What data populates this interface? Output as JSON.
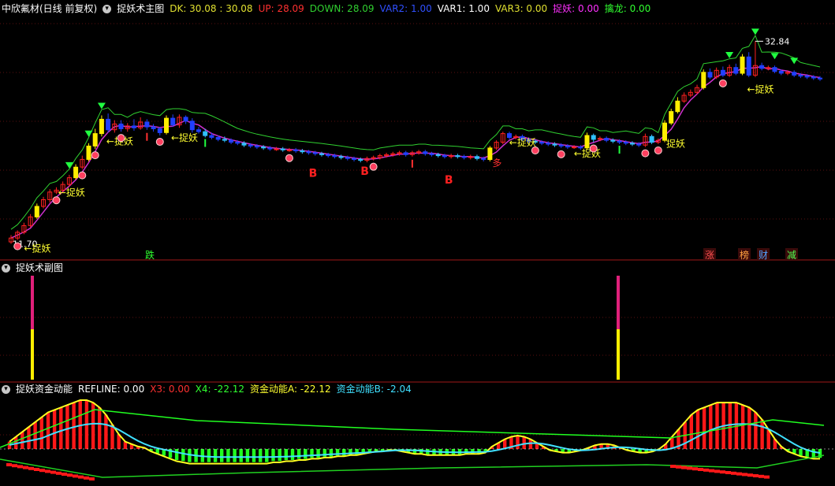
{
  "panel1": {
    "stock": "中欣氟材(日线 前复权)",
    "name": "捉妖术主图",
    "items": [
      {
        "label": "DK: 30.08 : 30.08",
        "color": "#e0e030"
      },
      {
        "label": "UP: 28.09",
        "color": "#ff3030"
      },
      {
        "label": "DOWN: 28.09",
        "color": "#30d030"
      },
      {
        "label": "VAR2: 1.00",
        "color": "#3050ff"
      },
      {
        "label": "VAR1: 1.00",
        "color": "#ffffff"
      },
      {
        "label": "VAR3: 0.00",
        "color": "#e0e030"
      },
      {
        "label": "捉妖: 0.00",
        "color": "#ff30ff"
      },
      {
        "label": "擒龙: 0.00",
        "color": "#30ff30"
      }
    ]
  },
  "panel2": {
    "name": "捉妖术副图"
  },
  "panel3": {
    "name": "捉妖资金动能",
    "items": [
      {
        "label": "REFLINE: 0.00",
        "color": "#ffffff"
      },
      {
        "label": "X3: 0.00",
        "color": "#ff3030"
      },
      {
        "label": "X4: -22.12",
        "color": "#30ff30"
      },
      {
        "label": "资金动能A: -22.12",
        "color": "#ffff30"
      },
      {
        "label": "资金动能B: -2.04",
        "color": "#40e0ff"
      }
    ]
  },
  "chart_data": {
    "type": "candlestick",
    "price_labels": {
      "high": "32.84",
      "low": "11.70"
    },
    "signal_text": {
      "zhuoyao": "捉妖",
      "arrow_zhuoyao": "←捉妖",
      "b": "B",
      "duo": "多",
      "die": "跌"
    },
    "events": [
      "涨",
      "榜",
      "财",
      "减"
    ],
    "candles": [
      {
        "o": 11.9,
        "c": 12.3,
        "h": 12.6,
        "l": 11.7,
        "up": true
      },
      {
        "o": 12.3,
        "c": 12.9,
        "h": 13.1,
        "l": 12.1,
        "up": true
      },
      {
        "o": 12.9,
        "c": 13.6,
        "h": 13.9,
        "l": 12.7,
        "up": true
      },
      {
        "o": 13.6,
        "c": 14.5,
        "h": 14.8,
        "l": 13.4,
        "up": true
      },
      {
        "o": 14.5,
        "c": 15.6,
        "h": 15.9,
        "l": 14.3,
        "up": true
      },
      {
        "o": 15.6,
        "c": 16.3,
        "h": 16.6,
        "l": 15.4,
        "up": true
      },
      {
        "o": 16.3,
        "c": 17.1,
        "h": 17.4,
        "l": 16.0,
        "up": true
      },
      {
        "o": 17.1,
        "c": 17.3,
        "h": 17.6,
        "l": 16.9,
        "up": true
      },
      {
        "o": 17.3,
        "c": 17.9,
        "h": 18.2,
        "l": 17.1,
        "up": true
      },
      {
        "o": 17.9,
        "c": 18.6,
        "h": 18.9,
        "l": 17.7,
        "up": true
      },
      {
        "o": 18.6,
        "c": 19.7,
        "h": 20.0,
        "l": 18.4,
        "up": true
      },
      {
        "o": 19.7,
        "c": 20.5,
        "h": 20.9,
        "l": 19.5,
        "up": true
      },
      {
        "o": 20.5,
        "c": 21.9,
        "h": 22.2,
        "l": 20.3,
        "up": true
      },
      {
        "o": 21.9,
        "c": 23.2,
        "h": 23.7,
        "l": 21.6,
        "up": true
      },
      {
        "o": 23.2,
        "c": 24.7,
        "h": 25.1,
        "l": 22.9,
        "up": true
      },
      {
        "o": 24.7,
        "c": 23.6,
        "h": 25.3,
        "l": 23.3,
        "up": false
      },
      {
        "o": 23.6,
        "c": 24.2,
        "h": 24.6,
        "l": 23.3,
        "up": true
      },
      {
        "o": 24.2,
        "c": 23.7,
        "h": 24.6,
        "l": 23.4,
        "up": false
      },
      {
        "o": 23.7,
        "c": 24.0,
        "h": 24.3,
        "l": 23.4,
        "up": true
      },
      {
        "o": 24.0,
        "c": 23.8,
        "h": 24.7,
        "l": 23.5,
        "up": false
      },
      {
        "o": 23.8,
        "c": 24.4,
        "h": 24.9,
        "l": 23.6,
        "up": true
      },
      {
        "o": 24.4,
        "c": 23.9,
        "h": 24.7,
        "l": 23.6,
        "up": false
      },
      {
        "o": 23.9,
        "c": 23.7,
        "h": 24.2,
        "l": 23.4,
        "up": false
      },
      {
        "o": 23.7,
        "c": 23.3,
        "h": 23.9,
        "l": 23.0,
        "up": false
      },
      {
        "o": 23.3,
        "c": 24.8,
        "h": 25.1,
        "l": 23.1,
        "up": true
      },
      {
        "o": 24.8,
        "c": 24.1,
        "h": 25.2,
        "l": 23.9,
        "up": false
      },
      {
        "o": 24.1,
        "c": 24.9,
        "h": 25.2,
        "l": 23.8,
        "up": true
      },
      {
        "o": 24.9,
        "c": 24.5,
        "h": 25.1,
        "l": 24.2,
        "up": false
      },
      {
        "o": 24.5,
        "c": 23.6,
        "h": 24.8,
        "l": 23.3,
        "up": false
      },
      {
        "o": 23.6,
        "c": 23.4,
        "h": 23.9,
        "l": 23.2,
        "up": false
      },
      {
        "o": 23.4,
        "c": 23.0,
        "h": 23.7,
        "l": 22.8,
        "up": false
      },
      {
        "o": 23.0,
        "c": 22.8,
        "h": 23.3,
        "l": 22.6,
        "up": false
      },
      {
        "o": 22.8,
        "c": 22.6,
        "h": 23.0,
        "l": 22.4,
        "up": false
      },
      {
        "o": 22.6,
        "c": 22.5,
        "h": 22.9,
        "l": 22.3,
        "up": false
      },
      {
        "o": 22.5,
        "c": 22.3,
        "h": 22.7,
        "l": 22.1,
        "up": false
      },
      {
        "o": 22.3,
        "c": 22.2,
        "h": 22.5,
        "l": 22.0,
        "up": false
      },
      {
        "o": 22.2,
        "c": 22.0,
        "h": 22.4,
        "l": 21.8,
        "up": false
      },
      {
        "o": 22.0,
        "c": 21.9,
        "h": 22.2,
        "l": 21.7,
        "up": false
      },
      {
        "o": 21.9,
        "c": 21.8,
        "h": 22.1,
        "l": 21.6,
        "up": false
      },
      {
        "o": 21.8,
        "c": 21.7,
        "h": 22.0,
        "l": 21.5,
        "up": false
      },
      {
        "o": 21.7,
        "c": 21.6,
        "h": 21.9,
        "l": 21.4,
        "up": false
      },
      {
        "o": 21.6,
        "c": 21.6,
        "h": 21.8,
        "l": 21.4,
        "up": true
      },
      {
        "o": 21.6,
        "c": 21.5,
        "h": 21.8,
        "l": 21.3,
        "up": false
      },
      {
        "o": 21.5,
        "c": 21.5,
        "h": 21.7,
        "l": 21.3,
        "up": true
      },
      {
        "o": 21.5,
        "c": 21.4,
        "h": 21.7,
        "l": 21.2,
        "up": false
      },
      {
        "o": 21.4,
        "c": 21.3,
        "h": 21.6,
        "l": 21.1,
        "up": false
      },
      {
        "o": 21.3,
        "c": 21.2,
        "h": 21.5,
        "l": 21.0,
        "up": false
      },
      {
        "o": 21.2,
        "c": 21.1,
        "h": 21.4,
        "l": 20.9,
        "up": false
      },
      {
        "o": 21.1,
        "c": 21.0,
        "h": 21.3,
        "l": 20.8,
        "up": false
      },
      {
        "o": 21.0,
        "c": 20.9,
        "h": 21.2,
        "l": 20.7,
        "up": false
      },
      {
        "o": 20.9,
        "c": 20.8,
        "h": 21.1,
        "l": 20.6,
        "up": false
      },
      {
        "o": 20.8,
        "c": 20.7,
        "h": 21.0,
        "l": 20.5,
        "up": false
      },
      {
        "o": 20.7,
        "c": 20.6,
        "h": 20.9,
        "l": 20.4,
        "up": false
      },
      {
        "o": 20.6,
        "c": 20.5,
        "h": 20.8,
        "l": 20.3,
        "up": false
      },
      {
        "o": 20.5,
        "c": 20.4,
        "h": 20.7,
        "l": 20.2,
        "up": false
      },
      {
        "o": 20.4,
        "c": 20.6,
        "h": 20.8,
        "l": 20.2,
        "up": true
      },
      {
        "o": 20.6,
        "c": 20.7,
        "h": 20.9,
        "l": 20.4,
        "up": true
      },
      {
        "o": 20.7,
        "c": 20.9,
        "h": 21.1,
        "l": 20.5,
        "up": true
      },
      {
        "o": 20.9,
        "c": 21.0,
        "h": 21.2,
        "l": 20.7,
        "up": true
      },
      {
        "o": 21.0,
        "c": 21.1,
        "h": 21.3,
        "l": 20.8,
        "up": true
      },
      {
        "o": 21.1,
        "c": 21.2,
        "h": 21.4,
        "l": 20.9,
        "up": true
      },
      {
        "o": 21.2,
        "c": 21.0,
        "h": 21.4,
        "l": 20.8,
        "up": false
      },
      {
        "o": 21.0,
        "c": 21.2,
        "h": 21.4,
        "l": 20.8,
        "up": true
      },
      {
        "o": 21.2,
        "c": 21.3,
        "h": 21.5,
        "l": 21.0,
        "up": true
      },
      {
        "o": 21.3,
        "c": 21.1,
        "h": 21.5,
        "l": 20.9,
        "up": false
      },
      {
        "o": 21.1,
        "c": 21.0,
        "h": 21.3,
        "l": 20.8,
        "up": false
      },
      {
        "o": 21.0,
        "c": 20.9,
        "h": 21.2,
        "l": 20.7,
        "up": false
      },
      {
        "o": 20.9,
        "c": 20.8,
        "h": 21.1,
        "l": 20.6,
        "up": false
      },
      {
        "o": 20.8,
        "c": 20.9,
        "h": 21.1,
        "l": 20.6,
        "up": true
      },
      {
        "o": 20.9,
        "c": 20.8,
        "h": 21.1,
        "l": 20.6,
        "up": false
      },
      {
        "o": 20.8,
        "c": 20.7,
        "h": 21.0,
        "l": 20.5,
        "up": false
      },
      {
        "o": 20.7,
        "c": 20.8,
        "h": 21.0,
        "l": 20.5,
        "up": true
      },
      {
        "o": 20.8,
        "c": 20.6,
        "h": 21.0,
        "l": 20.4,
        "up": false
      },
      {
        "o": 20.6,
        "c": 20.5,
        "h": 20.8,
        "l": 20.3,
        "up": false
      },
      {
        "o": 20.5,
        "c": 21.7,
        "h": 21.9,
        "l": 20.3,
        "up": true
      },
      {
        "o": 21.7,
        "c": 22.3,
        "h": 22.5,
        "l": 21.5,
        "up": true
      },
      {
        "o": 22.3,
        "c": 23.2,
        "h": 23.4,
        "l": 22.1,
        "up": true
      },
      {
        "o": 23.2,
        "c": 22.8,
        "h": 23.4,
        "l": 22.6,
        "up": false
      },
      {
        "o": 22.8,
        "c": 22.9,
        "h": 23.1,
        "l": 22.6,
        "up": true
      },
      {
        "o": 22.9,
        "c": 22.6,
        "h": 23.1,
        "l": 22.4,
        "up": false
      },
      {
        "o": 22.6,
        "c": 22.4,
        "h": 22.8,
        "l": 22.2,
        "up": false
      },
      {
        "o": 22.4,
        "c": 22.3,
        "h": 22.6,
        "l": 22.1,
        "up": false
      },
      {
        "o": 22.3,
        "c": 22.2,
        "h": 22.5,
        "l": 22.0,
        "up": false
      },
      {
        "o": 22.2,
        "c": 22.1,
        "h": 22.4,
        "l": 21.9,
        "up": false
      },
      {
        "o": 22.1,
        "c": 22.0,
        "h": 22.3,
        "l": 21.8,
        "up": false
      },
      {
        "o": 22.0,
        "c": 21.9,
        "h": 22.2,
        "l": 21.7,
        "up": false
      },
      {
        "o": 21.9,
        "c": 21.8,
        "h": 22.1,
        "l": 21.6,
        "up": false
      },
      {
        "o": 21.8,
        "c": 21.8,
        "h": 22.0,
        "l": 21.6,
        "up": true
      },
      {
        "o": 21.8,
        "c": 21.7,
        "h": 22.0,
        "l": 21.5,
        "up": false
      },
      {
        "o": 21.7,
        "c": 23.0,
        "h": 23.3,
        "l": 21.5,
        "up": true
      },
      {
        "o": 23.0,
        "c": 22.6,
        "h": 23.2,
        "l": 22.3,
        "up": false
      },
      {
        "o": 22.6,
        "c": 22.7,
        "h": 22.9,
        "l": 22.4,
        "up": true
      },
      {
        "o": 22.7,
        "c": 22.5,
        "h": 22.9,
        "l": 22.3,
        "up": false
      },
      {
        "o": 22.5,
        "c": 22.4,
        "h": 22.7,
        "l": 22.2,
        "up": false
      },
      {
        "o": 22.4,
        "c": 22.3,
        "h": 22.6,
        "l": 22.1,
        "up": false
      },
      {
        "o": 22.3,
        "c": 22.2,
        "h": 22.5,
        "l": 22.0,
        "up": false
      },
      {
        "o": 22.2,
        "c": 22.1,
        "h": 22.4,
        "l": 21.9,
        "up": false
      },
      {
        "o": 22.1,
        "c": 22.0,
        "h": 22.3,
        "l": 21.8,
        "up": false
      },
      {
        "o": 22.0,
        "c": 22.9,
        "h": 23.2,
        "l": 21.8,
        "up": true
      },
      {
        "o": 22.9,
        "c": 22.3,
        "h": 23.1,
        "l": 22.1,
        "up": false
      },
      {
        "o": 22.3,
        "c": 22.5,
        "h": 22.7,
        "l": 22.1,
        "up": true
      },
      {
        "o": 22.5,
        "c": 24.3,
        "h": 24.6,
        "l": 22.3,
        "up": true
      },
      {
        "o": 24.3,
        "c": 25.5,
        "h": 25.8,
        "l": 24.1,
        "up": true
      },
      {
        "o": 25.5,
        "c": 26.6,
        "h": 27.0,
        "l": 25.3,
        "up": true
      },
      {
        "o": 26.6,
        "c": 27.2,
        "h": 27.5,
        "l": 26.4,
        "up": true
      },
      {
        "o": 27.2,
        "c": 27.5,
        "h": 27.8,
        "l": 27.0,
        "up": true
      },
      {
        "o": 27.5,
        "c": 28.0,
        "h": 28.3,
        "l": 27.3,
        "up": true
      },
      {
        "o": 28.0,
        "c": 29.6,
        "h": 29.9,
        "l": 27.8,
        "up": true
      },
      {
        "o": 29.6,
        "c": 29.1,
        "h": 30.0,
        "l": 28.9,
        "up": false
      },
      {
        "o": 29.1,
        "c": 29.8,
        "h": 30.1,
        "l": 28.9,
        "up": true
      },
      {
        "o": 29.8,
        "c": 29.3,
        "h": 30.2,
        "l": 29.1,
        "up": false
      },
      {
        "o": 29.3,
        "c": 30.1,
        "h": 30.4,
        "l": 29.1,
        "up": true
      },
      {
        "o": 30.1,
        "c": 29.5,
        "h": 30.5,
        "l": 29.3,
        "up": false
      },
      {
        "o": 29.5,
        "c": 31.2,
        "h": 31.5,
        "l": 29.3,
        "up": true
      },
      {
        "o": 31.2,
        "c": 29.3,
        "h": 31.7,
        "l": 29.1,
        "up": false
      },
      {
        "o": 29.3,
        "c": 30.3,
        "h": 32.84,
        "l": 29.1,
        "up": true
      },
      {
        "o": 30.3,
        "c": 30.0,
        "h": 30.6,
        "l": 29.8,
        "up": false
      },
      {
        "o": 30.0,
        "c": 30.1,
        "h": 30.3,
        "l": 29.8,
        "up": true
      },
      {
        "o": 30.1,
        "c": 29.7,
        "h": 30.3,
        "l": 29.5,
        "up": false
      },
      {
        "o": 29.7,
        "c": 29.5,
        "h": 29.9,
        "l": 29.3,
        "up": false
      },
      {
        "o": 29.5,
        "c": 29.6,
        "h": 29.8,
        "l": 29.3,
        "up": true
      },
      {
        "o": 29.6,
        "c": 29.3,
        "h": 29.8,
        "l": 29.1,
        "up": false
      },
      {
        "o": 29.3,
        "c": 29.2,
        "h": 29.5,
        "l": 29.0,
        "up": false
      },
      {
        "o": 29.2,
        "c": 29.1,
        "h": 29.4,
        "l": 28.9,
        "up": false
      },
      {
        "o": 29.1,
        "c": 29.0,
        "h": 29.3,
        "l": 28.8,
        "up": false
      },
      {
        "o": 29.0,
        "c": 28.9,
        "h": 29.2,
        "l": 28.7,
        "up": false
      }
    ],
    "spikes_index": [
      5,
      104
    ],
    "flow_bars": [
      6,
      10,
      14,
      18,
      22,
      26,
      30,
      32,
      34,
      36,
      38,
      40,
      40,
      38,
      34,
      28,
      20,
      12,
      6,
      4,
      2,
      1,
      -2,
      -4,
      -6,
      -8,
      -10,
      -11,
      -12,
      -12,
      -12,
      -12,
      -12,
      -12,
      -12,
      -12,
      -12,
      -12,
      -12,
      -12,
      -12,
      -11,
      -11,
      -10,
      -10,
      -9,
      -9,
      -8,
      -8,
      -7,
      -7,
      -6,
      -6,
      -5,
      -5,
      -4,
      -3,
      -2,
      -2,
      -1,
      -1,
      -2,
      -3,
      -4,
      -4,
      -5,
      -5,
      -5,
      -5,
      -5,
      -5,
      -4,
      -4,
      -4,
      -3,
      2,
      5,
      8,
      10,
      11,
      10,
      8,
      5,
      2,
      -1,
      -2,
      -3,
      -3,
      -2,
      -1,
      1,
      3,
      4,
      4,
      3,
      1,
      -1,
      -2,
      -3,
      -3,
      -2,
      0,
      4,
      10,
      16,
      22,
      28,
      32,
      34,
      36,
      38,
      38,
      38,
      38,
      36,
      34,
      30,
      24,
      16,
      8,
      2,
      -2,
      -4,
      -6,
      -7,
      -8,
      -8
    ]
  }
}
